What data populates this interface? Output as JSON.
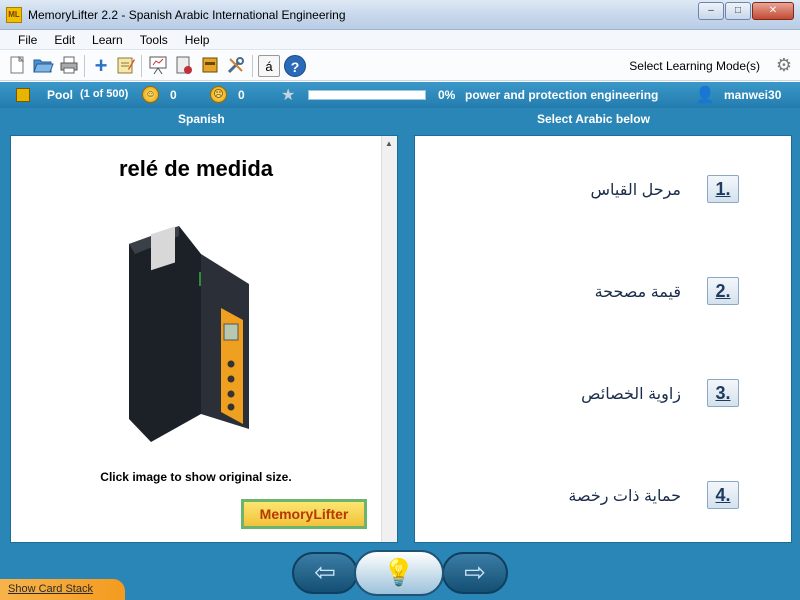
{
  "window": {
    "title": "MemoryLifter 2.2 - Spanish Arabic International Engineering",
    "app_icon": "ML",
    "minimize": "–",
    "maximize": "□",
    "close": "✕"
  },
  "menu": {
    "items": [
      "File",
      "Edit",
      "Learn",
      "Tools",
      "Help"
    ]
  },
  "toolbar": {
    "learning_mode_label": "Select Learning Mode(s)",
    "icons": [
      "new-icon",
      "open-icon",
      "print-icon",
      "add-icon",
      "edit-icon",
      "presentation-icon",
      "statistics-icon",
      "folder-icon",
      "settings-icon",
      "special-char-icon",
      "help-icon"
    ],
    "special_char": "á",
    "help_char": "?"
  },
  "status": {
    "pool_label": "Pool",
    "pool_count": "(1 of 500)",
    "happy_count": "0",
    "sad_count": "0",
    "progress_text": "0%",
    "progress_fraction": 0,
    "learning_module": "power and protection engineering",
    "user": "manwei30"
  },
  "columns": {
    "left_header": "Spanish",
    "right_header": "Select Arabic below"
  },
  "card": {
    "question": "relé de medida",
    "image_hint": "Click image to show original size.",
    "logo_text": "MemoryLifter"
  },
  "answers": [
    {
      "number": "1.",
      "text": "مرحل القياس"
    },
    {
      "number": "2.",
      "text": "قيمة مصححة"
    },
    {
      "number": "3.",
      "text": "زاوية الخصائص"
    },
    {
      "number": "4.",
      "text": "حماية ذات رخصة"
    }
  ],
  "nav": {
    "prev": "⇦",
    "hint": "💡",
    "next": "⇨"
  },
  "footer": {
    "show_card_stack": "Show Card Stack"
  },
  "colors": {
    "main_bg": "#2b86b8",
    "accent_orange": "#f49b1f"
  }
}
